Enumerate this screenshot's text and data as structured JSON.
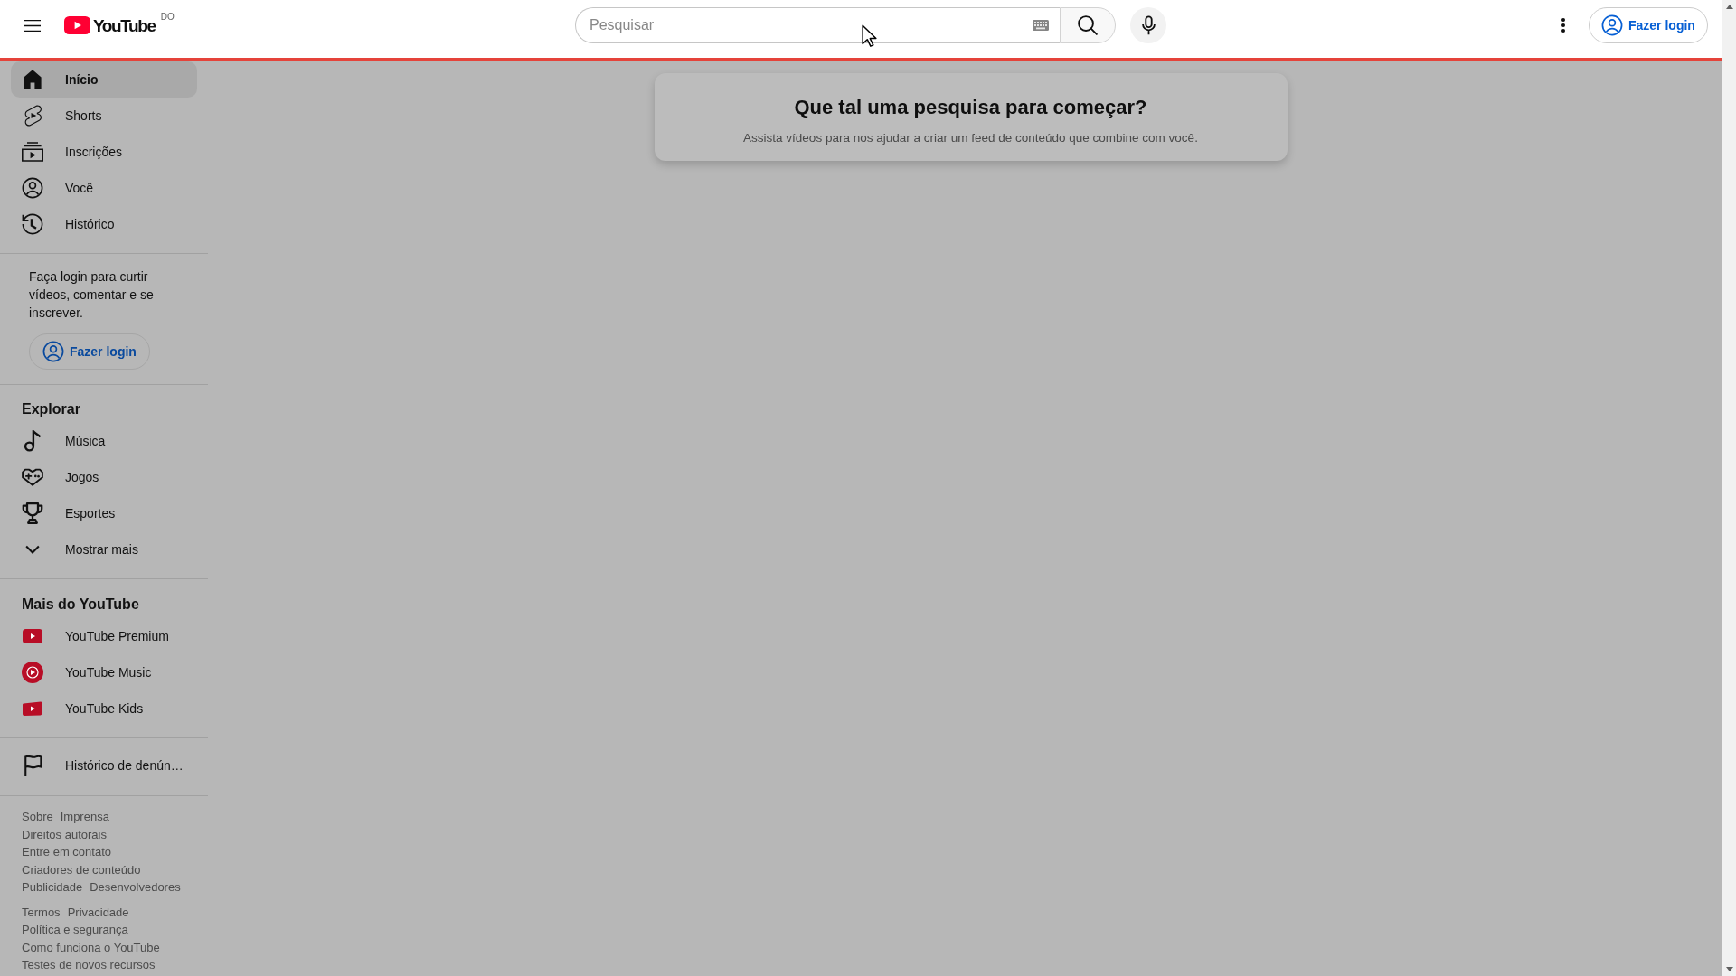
{
  "header": {
    "logo": {
      "text": "YouTube",
      "country_code": "DO"
    },
    "search": {
      "placeholder": "Pesquisar"
    },
    "login_button": "Fazer login",
    "progress": {
      "level": 1
    }
  },
  "sidebar": {
    "main_items": [
      {
        "label": "Início",
        "selected": true
      },
      {
        "label": "Shorts",
        "selected": false
      },
      {
        "label": "Inscrições",
        "selected": false
      },
      {
        "label": "Você",
        "selected": false
      },
      {
        "label": "Histórico",
        "selected": false
      }
    ],
    "login_prompt": {
      "text": "Faça login para curtir vídeos, comentar e se inscrever.",
      "button": "Fazer login"
    },
    "sections": [
      {
        "title": "Explorar",
        "items": [
          {
            "label": "Música",
            "selected": false
          },
          {
            "label": "Jogos",
            "selected": false
          },
          {
            "label": "Esportes",
            "selected": false
          },
          {
            "label": "Mostrar mais",
            "selected": false
          }
        ]
      },
      {
        "title": "Mais do YouTube",
        "items": [
          {
            "label": "YouTube Premium",
            "selected": false
          },
          {
            "label": "YouTube Music",
            "selected": false
          },
          {
            "label": "YouTube Kids",
            "selected": false
          }
        ]
      }
    ],
    "extra_items": [
      {
        "label": "Histórico de denún…",
        "selected": false
      }
    ],
    "footer": {
      "groups": [
        {
          "lines": [
            {
              "links": [
                "Sobre",
                "Imprensa"
              ]
            },
            {
              "links": [
                "Direitos autorais"
              ]
            },
            {
              "links": [
                "Entre em contato"
              ]
            },
            {
              "links": [
                "Criadores de conteúdo"
              ]
            },
            {
              "links": [
                "Publicidade",
                "Desenvolvedores"
              ]
            }
          ]
        },
        {
          "lines": [
            {
              "links": [
                "Termos",
                "Privacidade"
              ]
            },
            {
              "links": [
                "Política e segurança"
              ]
            },
            {
              "links": [
                "Como funciona o YouTube"
              ]
            },
            {
              "links": [
                "Testes de novos recursos"
              ]
            }
          ]
        }
      ]
    }
  },
  "feed": {
    "title": "Que tal uma pesquisa para começar?",
    "subtitle": "Assista vídeos para nos ajudar a criar um feed de conteúdo que combine com você."
  }
}
